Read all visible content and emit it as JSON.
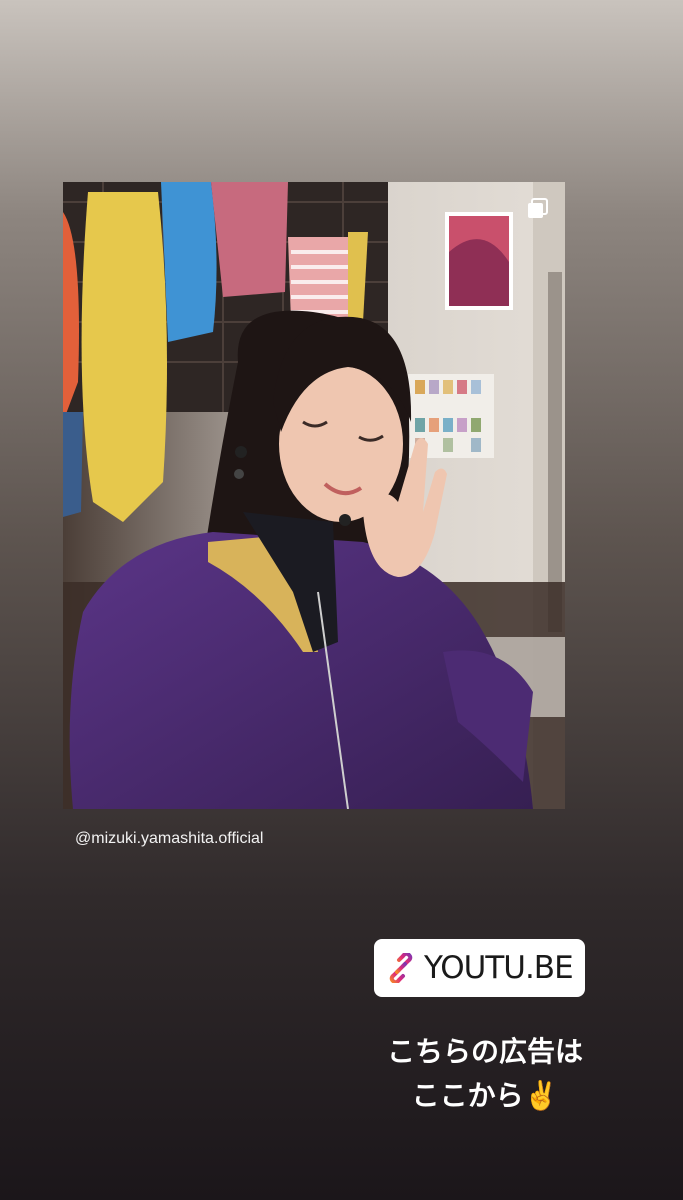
{
  "story": {
    "post_author": "@mizuki.yamashita.official",
    "link_label": "YOUTU.BE",
    "caption_line1": "こちらの広告は",
    "caption_line2": "ここから✌️"
  },
  "colors": {
    "jacket": "#4a2a6e",
    "sticker_bg": "#ffffff",
    "link_gradient_start": "#f58529",
    "link_gradient_end": "#8134af"
  },
  "icons": [
    "multiple-photos-icon",
    "link-icon"
  ]
}
